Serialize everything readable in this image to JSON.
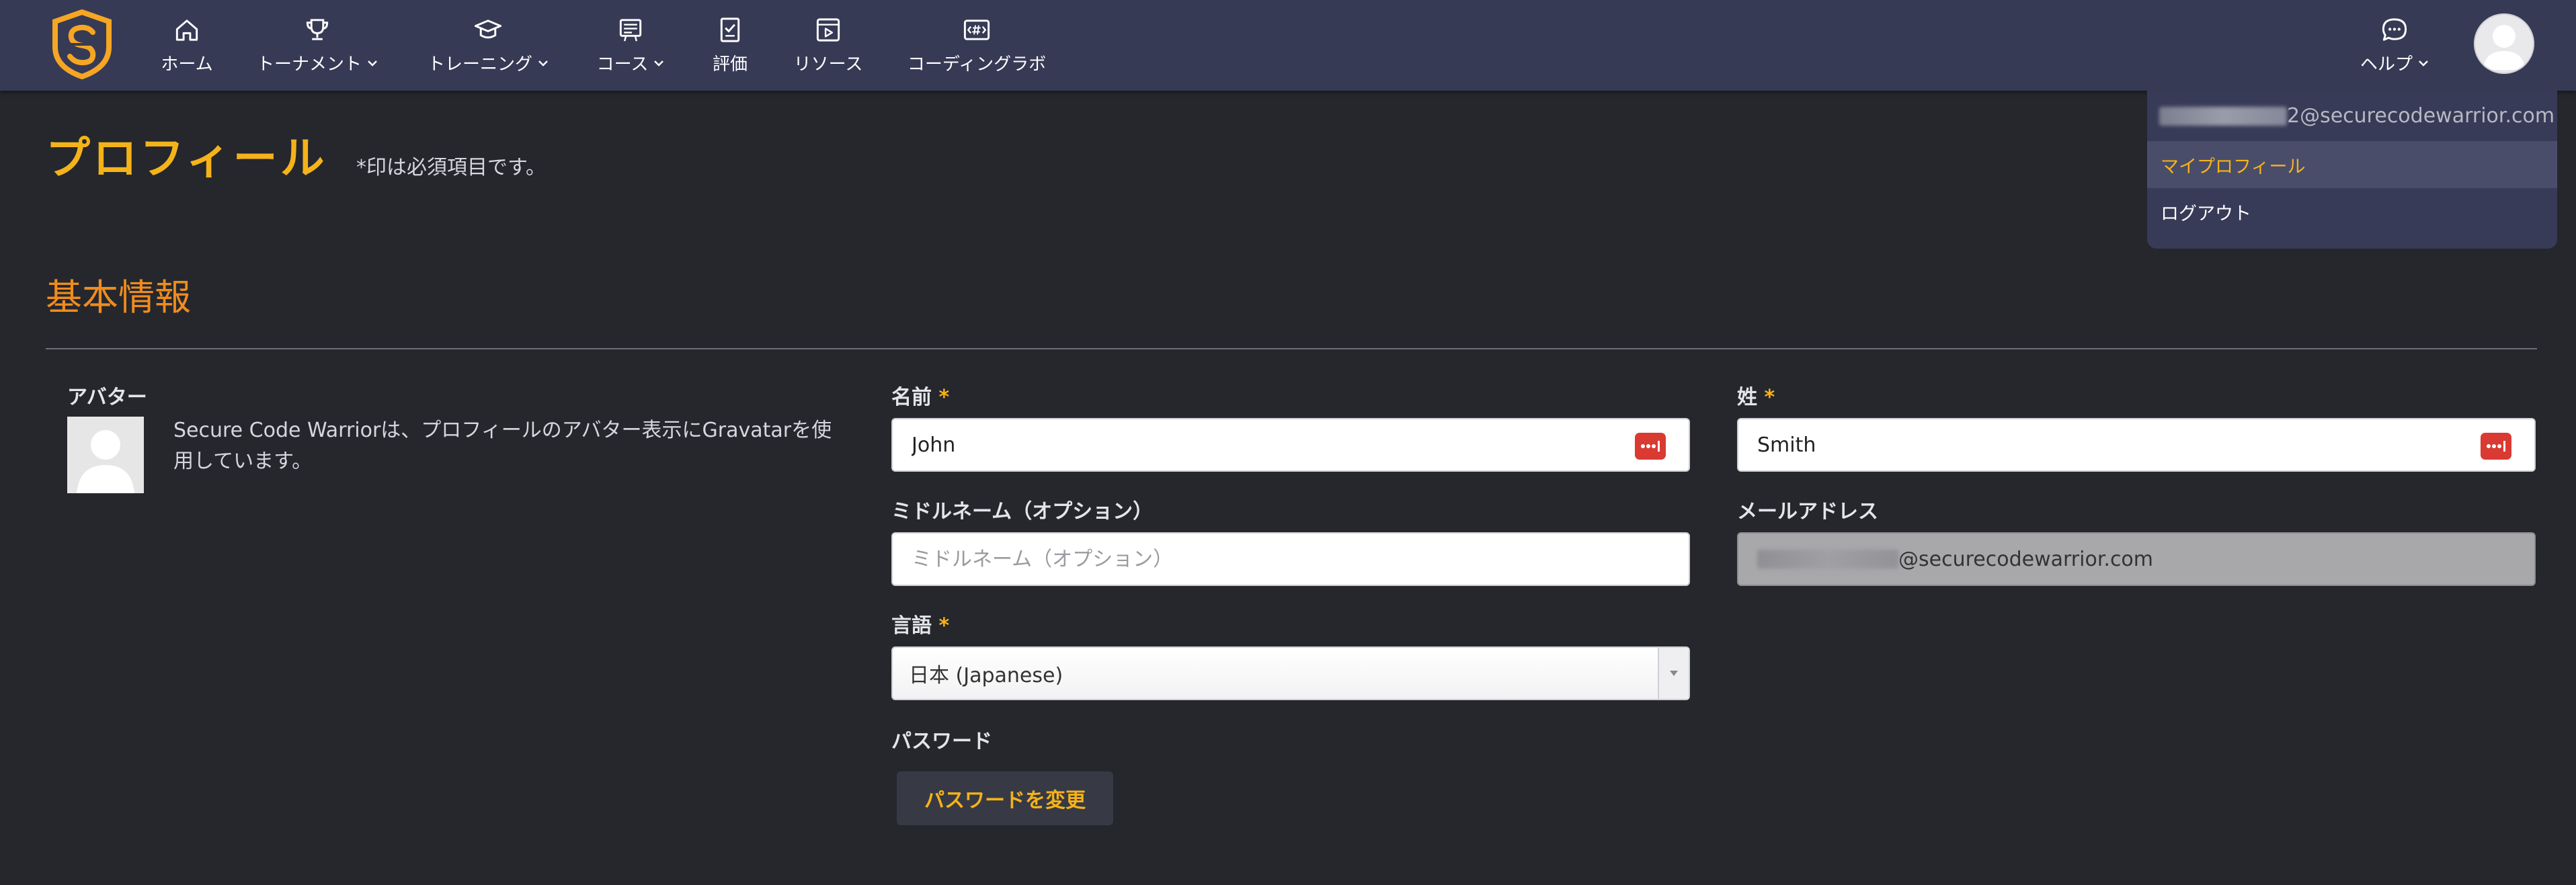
{
  "nav": {
    "items": [
      {
        "label": "ホーム",
        "icon": "home-icon"
      },
      {
        "label": "トーナメント",
        "icon": "trophy-icon"
      },
      {
        "label": "トレーニング",
        "icon": "graduation-cap-icon"
      },
      {
        "label": "コース",
        "icon": "course-icon"
      },
      {
        "label": "評価",
        "icon": "assessment-icon"
      },
      {
        "label": "リソース",
        "icon": "video-resource-icon"
      },
      {
        "label": "コーディングラボ",
        "icon": "code-lab-icon"
      }
    ],
    "help_label": "ヘルプ"
  },
  "user_menu": {
    "email_suffix": "2@securecodewarrior.com",
    "my_profile": "マイプロフィール",
    "logout": "ログアウト"
  },
  "page": {
    "title": "プロフィール",
    "required_note": "*印は必須項目です。"
  },
  "basic_info": {
    "section_title": "基本情報",
    "avatar_label": "アバター",
    "avatar_desc": "Secure Code Warriorは、プロフィールのアバター表示にGravatarを使用しています。",
    "first_name_label": "名前",
    "first_name_value": "John",
    "last_name_label": "姓",
    "last_name_value": "Smith",
    "middle_name_label": "ミドルネーム（オプション）",
    "middle_name_placeholder": "ミドルネーム（オプション）",
    "email_label": "メールアドレス",
    "email_suffix": "@securecodewarrior.com",
    "language_label": "言語",
    "language_value": "日本 (Japanese)",
    "password_label": "パスワード",
    "change_password_button": "パスワードを変更",
    "required_mark": "*"
  },
  "colors": {
    "accent": "#f5b31a",
    "section": "#f08c1e",
    "nav_bg": "#373a55",
    "page_bg": "#25272d"
  }
}
